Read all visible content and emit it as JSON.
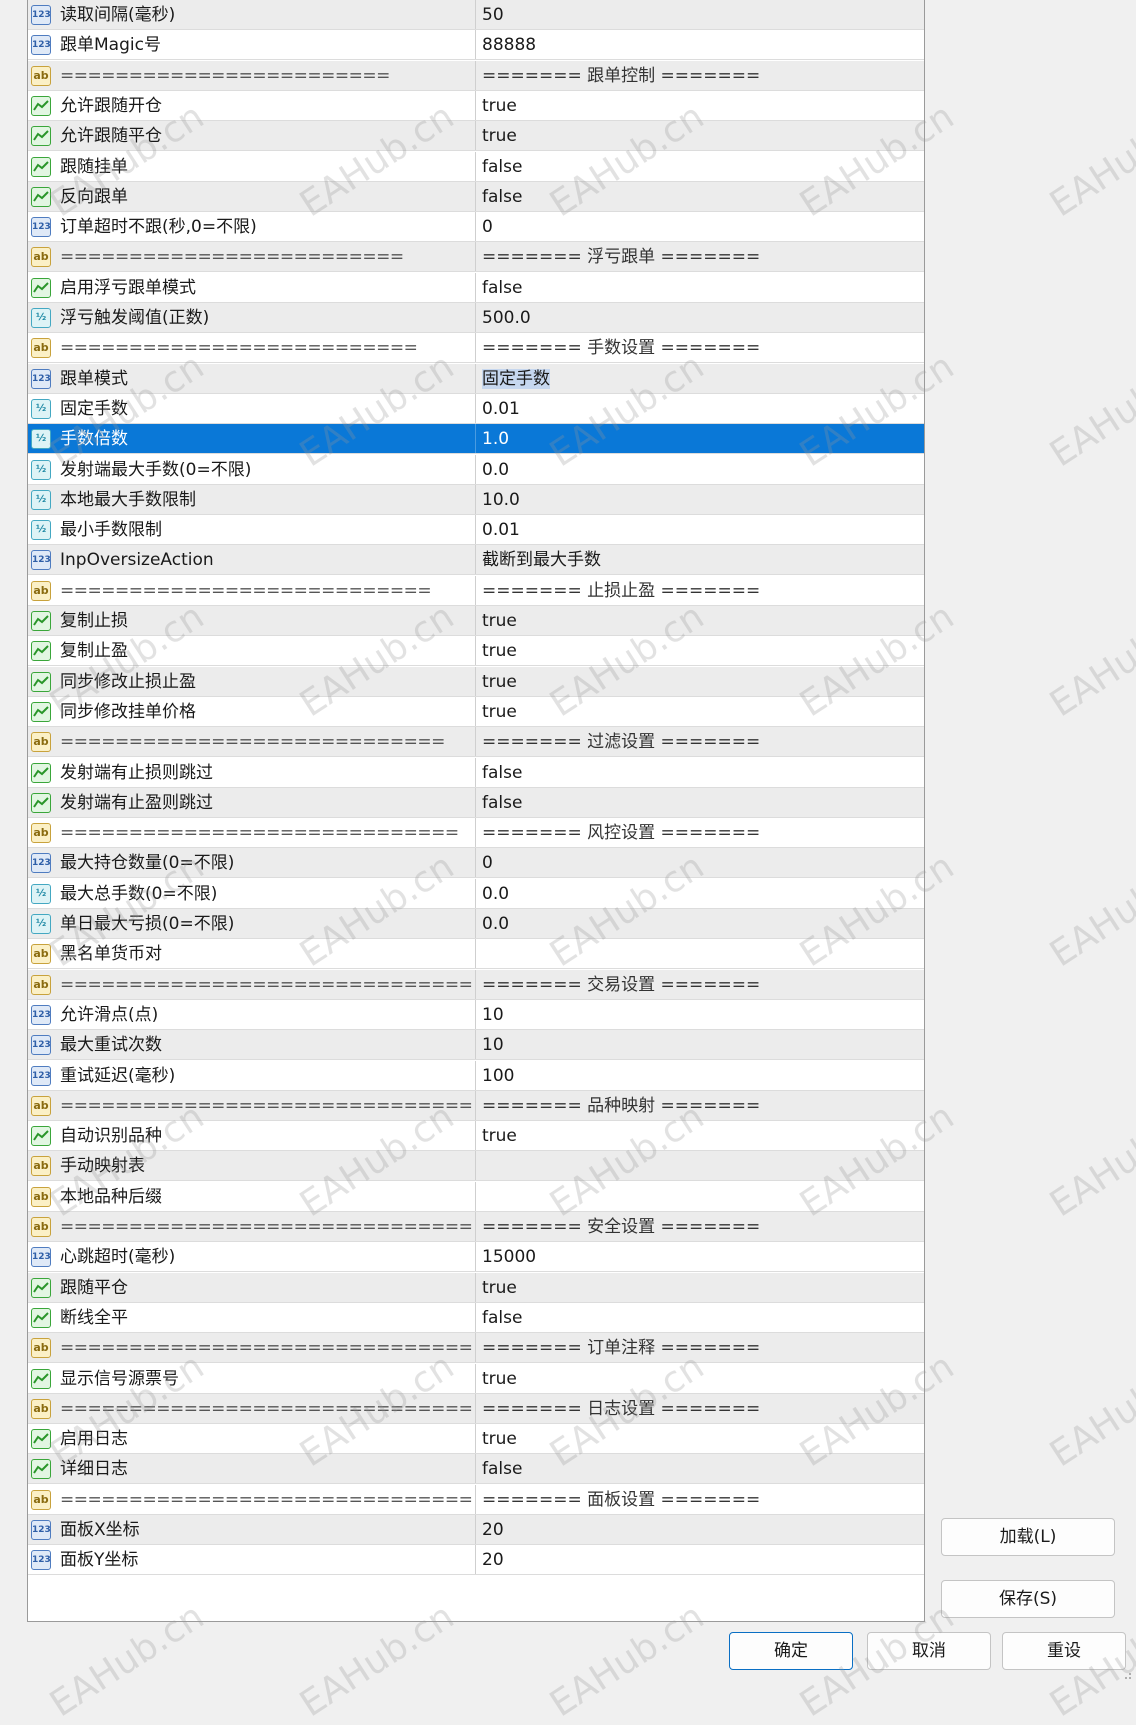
{
  "params": [
    {
      "type": "int",
      "name": "读取间隔(毫秒)",
      "value": "50"
    },
    {
      "type": "int",
      "name": "跟单Magic号",
      "value": "88888"
    },
    {
      "type": "str",
      "name": "========================",
      "value": "======= 跟单控制 =======",
      "sep": true
    },
    {
      "type": "bool",
      "name": "允许跟随开仓",
      "value": "true"
    },
    {
      "type": "bool",
      "name": "允许跟随平仓",
      "value": "true"
    },
    {
      "type": "bool",
      "name": "跟随挂单",
      "value": "false"
    },
    {
      "type": "bool",
      "name": "反向跟单",
      "value": "false"
    },
    {
      "type": "int",
      "name": "订单超时不跟(秒,0=不限)",
      "value": "0"
    },
    {
      "type": "str",
      "name": "=========================",
      "value": "======= 浮亏跟单 =======",
      "sep": true
    },
    {
      "type": "bool",
      "name": "启用浮亏跟单模式",
      "value": "false"
    },
    {
      "type": "dbl",
      "name": "浮亏触发阈值(正数)",
      "value": "500.0"
    },
    {
      "type": "str",
      "name": "==========================",
      "value": "======= 手数设置 =======",
      "sep": true
    },
    {
      "type": "int",
      "name": "跟单模式",
      "value": "固定手数",
      "highlight": true
    },
    {
      "type": "dbl",
      "name": "固定手数",
      "value": "0.01"
    },
    {
      "type": "dbl",
      "name": "手数倍数",
      "value": "1.0",
      "selected": true
    },
    {
      "type": "dbl",
      "name": "发射端最大手数(0=不限)",
      "value": "0.0"
    },
    {
      "type": "dbl",
      "name": "本地最大手数限制",
      "value": "10.0"
    },
    {
      "type": "dbl",
      "name": "最小手数限制",
      "value": "0.01"
    },
    {
      "type": "int",
      "name": "InpOversizeAction",
      "value": "截断到最大手数"
    },
    {
      "type": "str",
      "name": "===========================",
      "value": "======= 止损止盈 =======",
      "sep": true
    },
    {
      "type": "bool",
      "name": "复制止损",
      "value": "true"
    },
    {
      "type": "bool",
      "name": "复制止盈",
      "value": "true"
    },
    {
      "type": "bool",
      "name": "同步修改止损止盈",
      "value": "true"
    },
    {
      "type": "bool",
      "name": "同步修改挂单价格",
      "value": "true"
    },
    {
      "type": "str",
      "name": "============================",
      "value": "======= 过滤设置 =======",
      "sep": true
    },
    {
      "type": "bool",
      "name": "发射端有止损则跳过",
      "value": "false"
    },
    {
      "type": "bool",
      "name": "发射端有止盈则跳过",
      "value": "false"
    },
    {
      "type": "str",
      "name": "=============================",
      "value": "======= 风控设置 =======",
      "sep": true
    },
    {
      "type": "int",
      "name": "最大持仓数量(0=不限)",
      "value": "0"
    },
    {
      "type": "dbl",
      "name": "最大总手数(0=不限)",
      "value": "0.0"
    },
    {
      "type": "dbl",
      "name": "单日最大亏损(0=不限)",
      "value": "0.0"
    },
    {
      "type": "str",
      "name": "黑名单货币对",
      "value": ""
    },
    {
      "type": "str",
      "name": "===============================",
      "value": "======= 交易设置 =======",
      "sep": true
    },
    {
      "type": "int",
      "name": "允许滑点(点)",
      "value": "10"
    },
    {
      "type": "int",
      "name": "最大重试次数",
      "value": "10"
    },
    {
      "type": "int",
      "name": "重试延迟(毫秒)",
      "value": "100"
    },
    {
      "type": "str",
      "name": "================================",
      "value": "======= 品种映射 =======",
      "sep": true
    },
    {
      "type": "bool",
      "name": "自动识别品种",
      "value": "true"
    },
    {
      "type": "str",
      "name": "手动映射表",
      "value": ""
    },
    {
      "type": "str",
      "name": "本地品种后缀",
      "value": ""
    },
    {
      "type": "str",
      "name": "=================================",
      "value": "======= 安全设置 =======",
      "sep": true
    },
    {
      "type": "int",
      "name": "心跳超时(毫秒)",
      "value": "15000"
    },
    {
      "type": "bool",
      "name": "跟随平仓",
      "value": "true"
    },
    {
      "type": "bool",
      "name": "断线全平",
      "value": "false"
    },
    {
      "type": "str",
      "name": "==================================",
      "value": "======= 订单注释 =======",
      "sep": true
    },
    {
      "type": "bool",
      "name": "显示信号源票号",
      "value": "true"
    },
    {
      "type": "str",
      "name": "==================================?..",
      "value": "======= 日志设置 =======",
      "sep": true
    },
    {
      "type": "bool",
      "name": "启用日志",
      "value": "true"
    },
    {
      "type": "bool",
      "name": "详细日志",
      "value": "false"
    },
    {
      "type": "str",
      "name": "==================================?..",
      "value": "======= 面板设置 =======",
      "sep": true
    },
    {
      "type": "int",
      "name": "面板X坐标",
      "value": "20"
    },
    {
      "type": "int",
      "name": "面板Y坐标",
      "value": "20"
    }
  ],
  "icon_labels": {
    "int": "123",
    "dbl": "½",
    "str": "ab"
  },
  "buttons": {
    "load": "加载(L)",
    "save": "保存(S)",
    "ok": "确定",
    "cancel": "取消",
    "reset": "重设"
  },
  "watermark": "EAHub.cn",
  "colors": {
    "selected_row": "#0a78d7",
    "alt_row": "#ececec",
    "button_border_primary": "#0a6fc4"
  }
}
